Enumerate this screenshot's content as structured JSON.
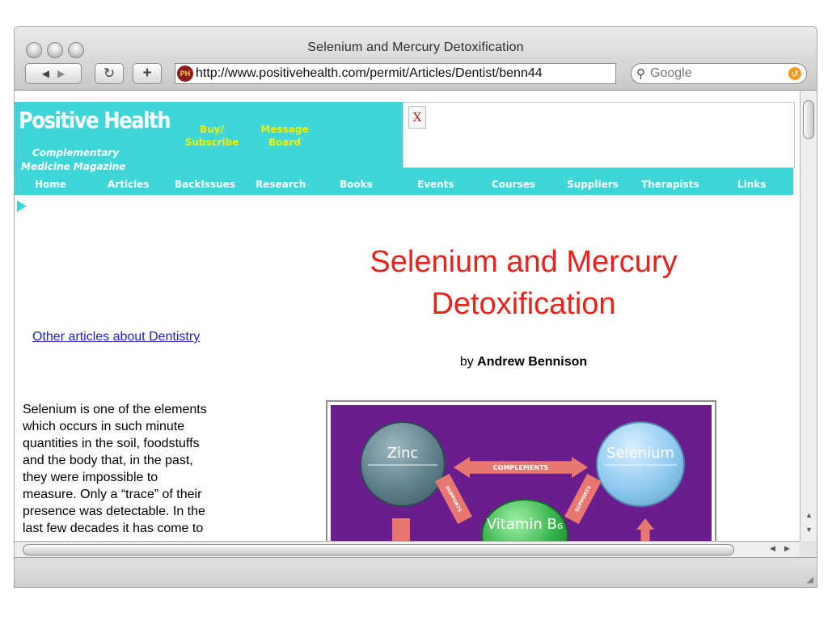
{
  "window": {
    "title": "Selenium and Mercury Detoxification"
  },
  "toolbar": {
    "url": "http://www.positivehealth.com/permit/Articles/Dentist/benn44",
    "favicon_text": "PH",
    "search_placeholder": "Google",
    "back_icon": "back-arrow-icon",
    "forward_icon": "forward-arrow-icon",
    "reload_icon": "reload-icon",
    "add_icon": "plus-icon"
  },
  "site": {
    "logo": "Positive Health",
    "tagline": [
      "Complementary",
      "Medicine Magazine"
    ],
    "top_links": [
      {
        "lines": [
          "Buy/",
          "Subscribe"
        ]
      },
      {
        "lines": [
          "Message",
          "Board"
        ]
      }
    ],
    "nav": [
      "Home",
      "Articles",
      "BackIssues",
      "Research",
      "Books",
      "Events",
      "Courses",
      "Suppliers",
      "Therapists",
      "Links"
    ],
    "ad_placeholder": "X"
  },
  "article": {
    "side_link": "Other articles about Dentistry",
    "title_line1": "Selenium and Mercury",
    "title_line2": "Detoxification",
    "by": "by",
    "author": "Andrew Bennison",
    "body_lines": [
      "Selenium is one of the elements",
      "which occurs in such minute",
      "quantities in the soil, foodstuffs",
      "and the body that, in the past,",
      "they were impossible to",
      "measure. Only a “trace” of their",
      "presence was detectable. In the",
      "last few decades it has come to"
    ]
  },
  "figure": {
    "pills": [
      "Zinc",
      "Selenium",
      "Vitamin B₆"
    ],
    "arrow_labels": [
      "COMPLEMENTS",
      "SUPPORTS",
      "SUPPORTS"
    ],
    "colors": {
      "background": "#6b1d8e",
      "zinc": "#5f7f8c",
      "selenium": "#8fc9ef",
      "vitamin": "#35b24a",
      "arrow": "#e87770"
    }
  },
  "colors": {
    "banner": "#3ed6d6",
    "title": "#e8231b",
    "link": "#1f24c8",
    "yellow": "#f0f000"
  }
}
